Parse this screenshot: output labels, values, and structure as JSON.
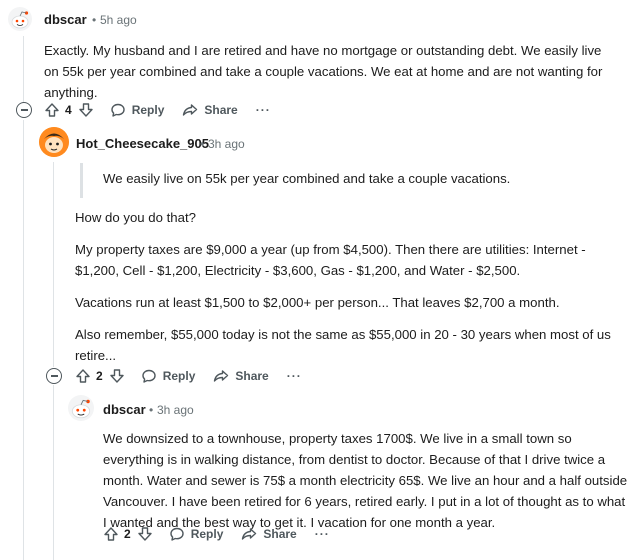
{
  "comments": [
    {
      "username": "dbscar",
      "separator": "•",
      "time": "5h ago",
      "paragraphs": [
        "Exactly. My husband and I are retired and have no mortgage or outstanding debt. We easily live on 55k per year combined and take a couple vacations. We eat at home and are not wanting for anything."
      ],
      "votes": "4",
      "reply_label": "Reply",
      "share_label": "Share",
      "more_label": "···"
    },
    {
      "username": "Hot_Cheesecake_905",
      "separator": "•",
      "time": "3h ago",
      "quote": "We easily live on 55k per year combined and take a couple vacations.",
      "paragraphs": [
        "How do you do that?",
        "My property taxes are $9,000 a year (up from $4,500). Then there are utilities: Internet - $1,200, Cell - $1,200, Electricity - $3,600, Gas - $1,200, and Water - $2,500.",
        "Vacations run at least $1,500 to $2,000+ per person... That leaves $2,700 a month.",
        "Also remember, $55,000 today is not the same as $55,000 in 20 - 30 years when most of us retire..."
      ],
      "votes": "2",
      "reply_label": "Reply",
      "share_label": "Share",
      "more_label": "···"
    },
    {
      "username": "dbscar",
      "separator": "•",
      "time": "3h ago",
      "paragraphs": [
        "We downsized to a townhouse, property taxes 1700$. We live in a small town so everything is in walking distance, from dentist to doctor. Because of that I drive twice a month. Water and sewer is 75$ a month electricity 65$. We live an hour and a half outside Vancouver. I have been retired for 6 years, retired early. I put in a lot of thought as to what I wanted and the best way to get it. I vacation for one month a year."
      ],
      "votes": "2",
      "reply_label": "Reply",
      "share_label": "Share",
      "more_label": "···"
    }
  ],
  "colors": {
    "text": "#1c1c1c",
    "meta": "#6a7377",
    "action": "#4f585d",
    "thread": "#dfe3e6"
  }
}
